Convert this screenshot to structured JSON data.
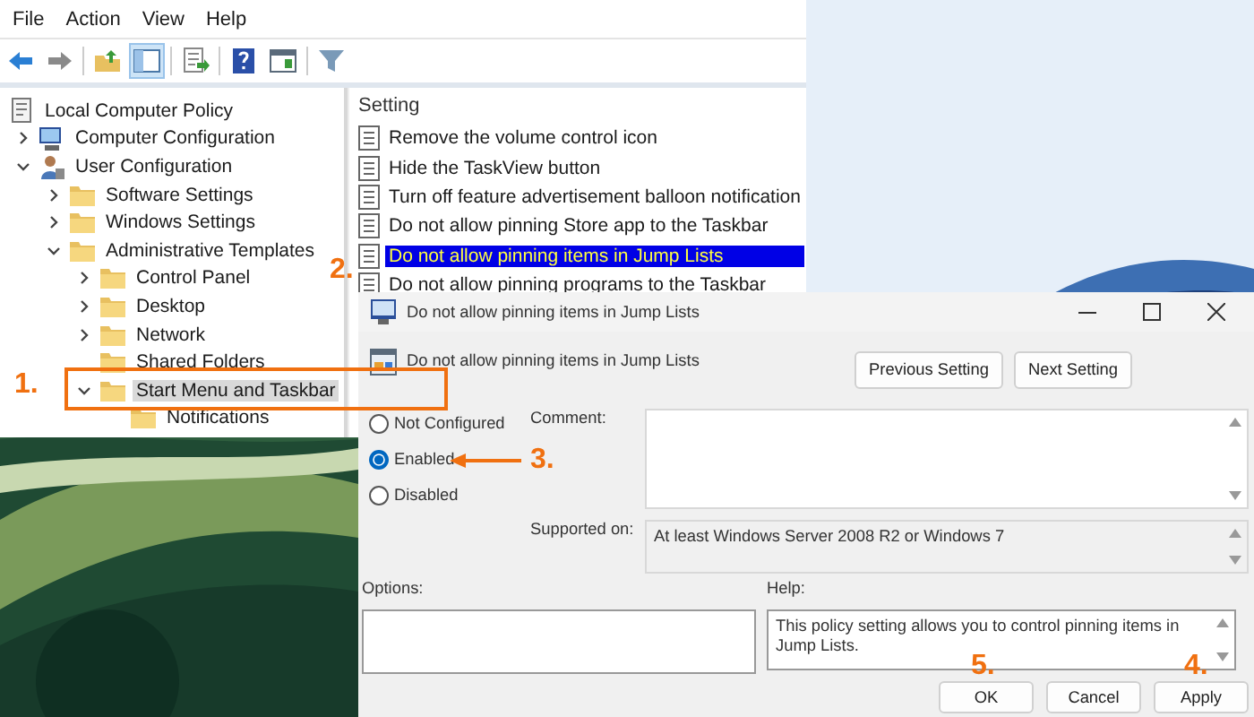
{
  "editor": {
    "menu": [
      "File",
      "Action",
      "View",
      "Help"
    ],
    "tree": [
      {
        "label": "Local Computer Policy",
        "kind": "policy",
        "selected": false,
        "children": [
          {
            "label": "Computer Configuration",
            "kind": "computer",
            "expanded": false,
            "selected": false
          },
          {
            "label": "User Configuration",
            "kind": "user",
            "expanded": true,
            "selected": false,
            "children": [
              {
                "label": "Software Settings",
                "kind": "folder",
                "expanded": false,
                "selected": false
              },
              {
                "label": "Windows Settings",
                "kind": "folder",
                "expanded": false,
                "selected": false
              },
              {
                "label": "Administrative Templates",
                "kind": "folder",
                "expanded": true,
                "selected": false,
                "children": [
                  {
                    "label": "Control Panel",
                    "kind": "folder",
                    "expanded": false,
                    "selected": false
                  },
                  {
                    "label": "Desktop",
                    "kind": "folder",
                    "expanded": false,
                    "selected": false
                  },
                  {
                    "label": "Network",
                    "kind": "folder",
                    "expanded": false,
                    "selected": false
                  },
                  {
                    "label": "Shared Folders",
                    "kind": "folder",
                    "selected": false
                  },
                  {
                    "label": "Start Menu and Taskbar",
                    "kind": "folder",
                    "expanded": true,
                    "selected": true,
                    "children": [
                      {
                        "label": "Notifications",
                        "kind": "folder",
                        "selected": false
                      }
                    ]
                  }
                ]
              }
            ]
          }
        ]
      }
    ],
    "list": {
      "column": "Setting",
      "rows": [
        {
          "label": "Remove the volume control icon",
          "selected": false
        },
        {
          "label": "Hide the TaskView button",
          "selected": false
        },
        {
          "label": "Turn off feature advertisement balloon notification",
          "selected": false
        },
        {
          "label": "Do not allow pinning Store app to the Taskbar",
          "selected": false
        },
        {
          "label": "Do not allow pinning items in Jump Lists",
          "selected": true
        },
        {
          "label": "Do not allow pinning programs to the Taskbar",
          "selected": false
        }
      ]
    }
  },
  "dialog": {
    "title": "Do not allow pinning items in Jump Lists",
    "header": "Do not allow pinning items in Jump Lists",
    "nav_buttons": [
      "Previous Setting",
      "Next Setting"
    ],
    "states": [
      {
        "label": "Not Configured",
        "selected": false
      },
      {
        "label": "Enabled",
        "selected": true
      },
      {
        "label": "Disabled",
        "selected": false
      }
    ],
    "comment_label": "Comment:",
    "supported_label": "Supported on:",
    "supported": "At least Windows Server 2008 R2 or Windows 7",
    "options_label": "Options:",
    "help_label": "Help:",
    "help": "This policy setting allows you to control pinning items in Jump Lists.",
    "buttons": [
      "OK",
      "Cancel",
      "Apply"
    ]
  },
  "annotations": [
    "1.",
    "2.",
    "3.",
    "4.",
    "5."
  ]
}
